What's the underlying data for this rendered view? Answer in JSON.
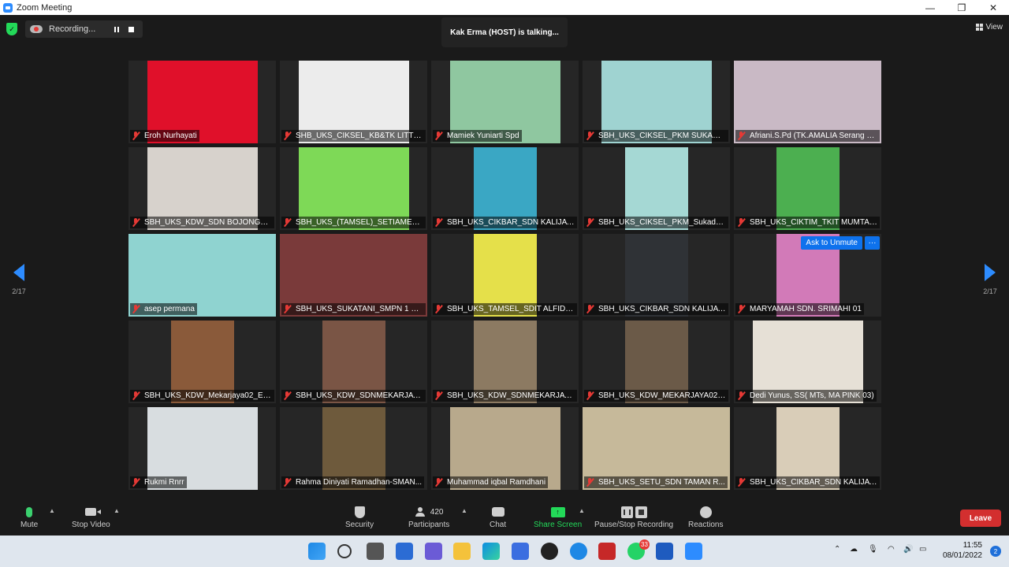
{
  "window": {
    "title": "Zoom Meeting",
    "controls": [
      "—",
      "❐",
      "✕"
    ]
  },
  "meeting": {
    "recording_label": "Recording...",
    "talking_indicator": "Kak Erma (HOST) is talking...",
    "view_label": "View",
    "page_left": "2/17",
    "page_right": "2/17",
    "ask_to_unmute_label": "Ask to Unmute",
    "more_label": "···"
  },
  "participants": [
    {
      "name": "Eroh Nurhayati",
      "bg": "#e0102a",
      "video": true
    },
    {
      "name": "SHB_UKS_CIKSEL_KB&TK LITTLE B...",
      "bg": "#ececec",
      "video": true
    },
    {
      "name": "Mamiek Yuniarti Spd",
      "bg": "#8fc7a0",
      "video": true
    },
    {
      "name": "SBH_UKS_CIKSEL_PKM SUKADAM...",
      "bg": "#9fd3d1",
      "video": true
    },
    {
      "name": "Afriani.S.Pd (TK.AMALIA Serang Ba...",
      "bg": "#c9b9c5",
      "video": true,
      "wide": true
    },
    {
      "name": "SBH_UKS_KDW_SDN BOJONGSA...",
      "bg": "#d7d2cc",
      "video": true
    },
    {
      "name": "SBH_UKS_(TAMSEL)_SETIAMEKAR...",
      "bg": "#7ed957",
      "video": true
    },
    {
      "name": "SBH_UKS_CIKBAR_SDN KALIJAYA ...",
      "bg": "#3aa7c4",
      "video": true,
      "narrow": true
    },
    {
      "name": "SBH_UKS_CIKSEL_PKM_Sukadami...",
      "bg": "#a5d8d4",
      "video": true,
      "narrow": true
    },
    {
      "name": "SBH_UKS_CIKTIM_TKIT MUMTAZ_...",
      "bg": "#4caf50",
      "video": true,
      "narrow": true
    },
    {
      "name": "asep permana",
      "bg": "#8fd3d0",
      "video": true,
      "wide": true
    },
    {
      "name": "SBH_UKS_SUKATANI_SMPN 1 SU...",
      "bg": "#7a3a3a",
      "video": true,
      "wide": true
    },
    {
      "name": "SBH_UKS_TAMSEL_SDIT ALFIDAA_...",
      "bg": "#e5e04a",
      "video": true,
      "narrow": true
    },
    {
      "name": "SBH_UKS_CIKBAR_SDN KALIJAYA_...",
      "bg": "#2f3236",
      "video": true,
      "narrow": true
    },
    {
      "name": "MARYAMAH SDN. SRIMAHI 01",
      "bg": "#d27ab8",
      "video": true,
      "narrow": true,
      "unmute": true
    },
    {
      "name": "SBH_UKS_KDW_Mekarjaya02_Ene...",
      "bg": "#8a5a3a",
      "video": true,
      "narrow": true
    },
    {
      "name": "SBH_UKS_KDW_SDNMEKARJAYA0...",
      "bg": "#7a5545",
      "video": true,
      "narrow": true
    },
    {
      "name": "SBH_UKS_KDW_SDNMEKARJAYA0...",
      "bg": "#8c7a62",
      "video": true,
      "narrow": true
    },
    {
      "name": "SBH_UKS_KDW_MEKARJAYA02_SI...",
      "bg": "#6b5a48",
      "video": true,
      "narrow": true
    },
    {
      "name": "Dedi Yunus, SS( MTs, MA PINK 03)",
      "bg": "#e6e0d6",
      "video": true
    },
    {
      "name": "Rukmi Rnrr",
      "bg": "#d8dde0",
      "video": true
    },
    {
      "name": "Rahma Diniyati Ramadhan-SMAN...",
      "bg": "#6e5a3c",
      "video": true,
      "narrow": true
    },
    {
      "name": "Muhammad iqbal Ramdhani",
      "bg": "#b8a98c",
      "video": true
    },
    {
      "name": "SBH_UKS_SETU_SDN TAMAN R...",
      "bg": "#c6b99a",
      "video": true,
      "wide": true
    },
    {
      "name": "SBH_UKS_CIKBAR_SDN KALIJAYA ...",
      "bg": "#d9cdb8",
      "video": true,
      "narrow": true
    }
  ],
  "toolbar": {
    "mute": "Mute",
    "stop_video": "Stop Video",
    "security": "Security",
    "participants": "Participants",
    "participants_count": "420",
    "chat": "Chat",
    "share_screen": "Share Screen",
    "pause_stop_recording": "Pause/Stop Recording",
    "reactions": "Reactions",
    "leave": "Leave"
  },
  "taskbar": {
    "whatsapp_badge": "33",
    "time": "11:55",
    "date": "08/01/2022",
    "notifications": "2"
  },
  "colors": {
    "accent": "#2d8cff",
    "green": "#23d959",
    "leave": "#d32f2f",
    "muted": "#e53935"
  }
}
